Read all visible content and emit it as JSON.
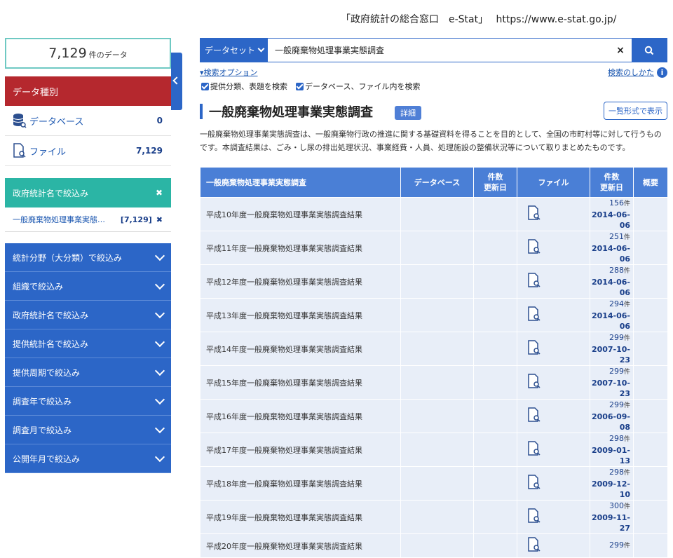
{
  "caption": "「政府統計の総合窓口　e-Stat」　 https://www.e-stat.go.jp/",
  "sidebar": {
    "count_value": "7,129",
    "count_unit": "件のデータ",
    "data_type_header": "データ種別",
    "data_types": [
      {
        "label": "データベース",
        "count": "0",
        "icon": "database-icon"
      },
      {
        "label": "ファイル",
        "count": "7,129",
        "icon": "file-search-icon"
      }
    ],
    "active_filter": {
      "header": "政府統計名で絞込み",
      "selected_label": "一般廃棄物処理事業実態…",
      "selected_count": "[7,129]"
    },
    "facets": [
      "統計分野（大分類）で絞込み",
      "組織で絞込み",
      "政府統計名で絞込み",
      "提供統計名で絞込み",
      "提供周期で絞込み",
      "調査年で絞込み",
      "調査月で絞込み",
      "公開年月で絞込み"
    ]
  },
  "search": {
    "type_label": "データセット",
    "query": "一般廃棄物処理事業実態調査",
    "clear_glyph": "×",
    "options_link": "▾検索オプション",
    "help_link": "検索のしかた",
    "checkbox_1": "提供分類、表題を検索",
    "checkbox_2": "データベース、ファイル内を検索"
  },
  "result": {
    "title": "一般廃棄物処理事業実態調査",
    "detail_badge": "詳細",
    "list_button": "一覧形式で表示",
    "description": "一般廃棄物処理事業実態調査は、一般廃棄物行政の推進に関する基礎資料を得ることを目的として、全国の市町村等に対して行うものです。本調査結果は、ごみ・し尿の排出処理状況、事業経費・人員、処理施設の整備状況等について取りまとめたものです。"
  },
  "table": {
    "headers": {
      "name": "一般廃棄物処理事業実態調査",
      "database": "データベース",
      "count_line1": "件数",
      "count_line2": "更新日",
      "file": "ファイル",
      "summary": "概要"
    },
    "unit": "件",
    "rows": [
      {
        "name": "平成10年度一般廃棄物処理事業実態調査結果",
        "count": "156",
        "date": "2014-06-06"
      },
      {
        "name": "平成11年度一般廃棄物処理事業実態調査結果",
        "count": "251",
        "date": "2014-06-06"
      },
      {
        "name": "平成12年度一般廃棄物処理事業実態調査結果",
        "count": "288",
        "date": "2014-06-06"
      },
      {
        "name": "平成13年度一般廃棄物処理事業実態調査結果",
        "count": "294",
        "date": "2014-06-06"
      },
      {
        "name": "平成14年度一般廃棄物処理事業実態調査結果",
        "count": "299",
        "date": "2007-10-23"
      },
      {
        "name": "平成15年度一般廃棄物処理事業実態調査結果",
        "count": "299",
        "date": "2007-10-23"
      },
      {
        "name": "平成16年度一般廃棄物処理事業実態調査結果",
        "count": "299",
        "date": "2006-09-08"
      },
      {
        "name": "平成17年度一般廃棄物処理事業実態調査結果",
        "count": "298",
        "date": "2009-01-13"
      },
      {
        "name": "平成18年度一般廃棄物処理事業実態調査結果",
        "count": "298",
        "date": "2009-12-10"
      },
      {
        "name": "平成19年度一般廃棄物処理事業実態調査結果",
        "count": "300",
        "date": "2009-11-27"
      },
      {
        "name": "平成20年度一般廃棄物処理事業実態調査結果",
        "count": "299",
        "date": ""
      }
    ]
  }
}
